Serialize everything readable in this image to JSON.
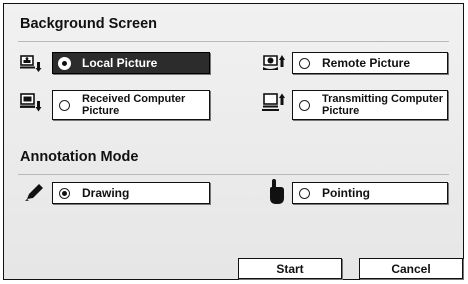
{
  "background_screen": {
    "title": "Background Screen",
    "local_picture": "Local Picture",
    "remote_picture": "Remote Picture",
    "received_computer_picture": "Received Computer Picture",
    "transmitting_computer_picture": "Transmitting Computer Picture"
  },
  "annotation_mode": {
    "title": "Annotation Mode",
    "drawing": "Drawing",
    "pointing": "Pointing"
  },
  "buttons": {
    "start": "Start",
    "cancel": "Cancel"
  },
  "selected": {
    "background_screen": "local_picture",
    "annotation_mode": "drawing"
  },
  "icons": {
    "local": "local-camera-icon",
    "remote": "remote-camera-icon",
    "received": "received-computer-icon",
    "transmitting": "transmitting-computer-icon",
    "drawing": "pencil-icon",
    "pointing": "pointing-hand-icon"
  },
  "colors": {
    "selected_bg": "#2c2c2c",
    "panel_bg": "#ececec"
  }
}
